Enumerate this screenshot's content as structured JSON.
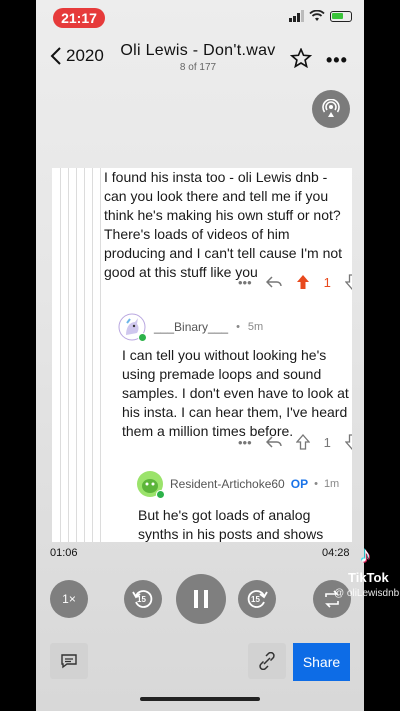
{
  "status": {
    "time": "21:17"
  },
  "header": {
    "back_label": "2020",
    "title": "Oli Lewis - Don't.wav",
    "position": "8 of 177"
  },
  "comments": [
    {
      "text": "I found his insta too - oli Lewis dnb - can you look there and tell me if you think he's making his own stuff or not? There's loads of videos of him producing and I can't tell cause I'm not good at this stuff like you",
      "votes": "1",
      "upvoted": true
    },
    {
      "username": "___Binary___",
      "age": "5m",
      "text": "I can tell you without looking he's using premade loops and sound samples. I don't even have to look at his insta. I can hear them, I've heard them a million times before.",
      "votes": "1"
    },
    {
      "username": "Resident-Artichoke60",
      "op_badge": "OP",
      "age": "1m",
      "text": "But he's got loads of analog synths in his posts and shows sound"
    }
  ],
  "player": {
    "elapsed": "01:06",
    "total": "04:28",
    "speed": "1×",
    "skip_back": "15",
    "skip_forward": "15"
  },
  "bottom": {
    "share_label": "Share"
  },
  "watermark": {
    "label": "TikTok",
    "handle": "@ oliLewisdnb"
  },
  "colors": {
    "accent_blue": "#0d6ce6",
    "upvote_red": "#e8491d",
    "status_red": "#e63a3a"
  }
}
